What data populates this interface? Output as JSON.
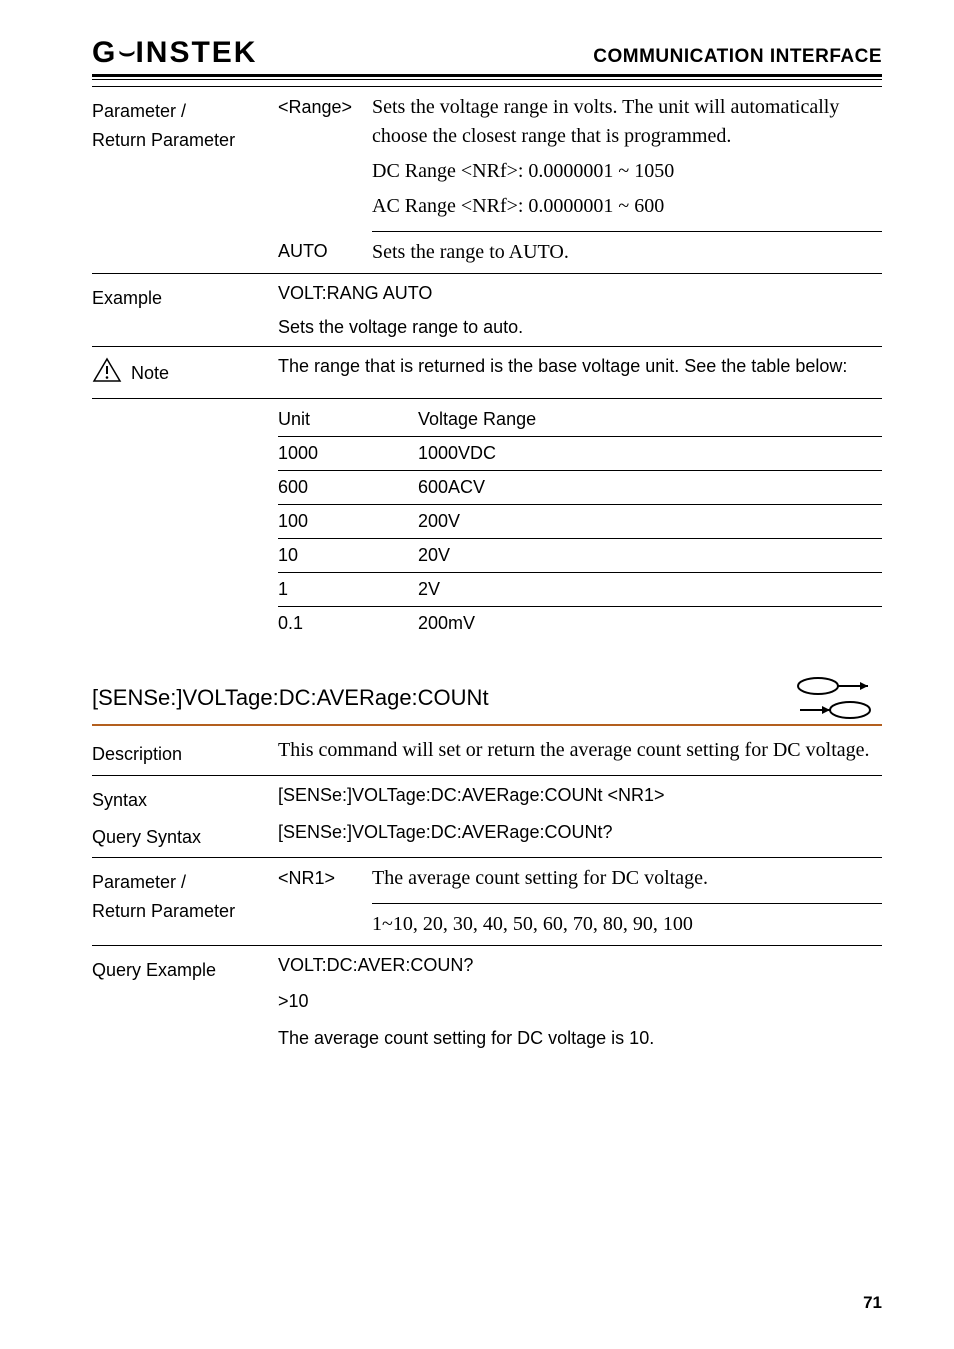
{
  "header": {
    "logo": "GWINSTEK",
    "section": "COMMUNICATION INTERFACE"
  },
  "block1": {
    "param_label_l1": "Parameter /",
    "param_label_l2": "Return Parameter",
    "range_token": "<Range>",
    "range_desc": "Sets the voltage range in volts. The unit will automatically choose the closest range that is programmed.",
    "dc_range": "DC Range <NRf>: 0.0000001 ~ 1050",
    "ac_range": "AC Range <NRf>: 0.0000001 ~ 600",
    "auto_token": "AUTO",
    "auto_desc": "Sets the range to AUTO.",
    "example_label": "Example",
    "example_val": "VOLT:RANG AUTO",
    "example_desc": "Sets the voltage range to auto.",
    "note_label": "Note",
    "note_text": "The range that is returned is the base voltage unit. See the table below:",
    "vr_header_unit": "Unit",
    "vr_header_range": "Voltage Range",
    "vr_rows": [
      {
        "unit": "1000",
        "range": "1000VDC"
      },
      {
        "unit": "600",
        "range": "600ACV"
      },
      {
        "unit": "100",
        "range": "200V"
      },
      {
        "unit": "10",
        "range": "20V"
      },
      {
        "unit": "1",
        "range": "2V"
      },
      {
        "unit": "0.1",
        "range": "200mV"
      }
    ]
  },
  "cmd_heading": "[SENSe:]VOLTage:DC:AVERage:COUNt",
  "block2": {
    "desc_label": "Description",
    "desc_text": "This command will set or return the average count setting for DC voltage.",
    "syntax_label": "Syntax",
    "syntax_val": "[SENSe:]VOLTage:DC:AVERage:COUNt <NR1>",
    "qsyntax_label": "Query Syntax",
    "qsyntax_val": "[SENSe:]VOLTage:DC:AVERage:COUNt?",
    "param_label_l1": "Parameter /",
    "param_label_l2": "Return Parameter",
    "nr1_token": "<NR1>",
    "nr1_desc": "The average count setting for DC voltage.",
    "nr1_values": "1~10, 20, 30, 40, 50, 60, 70, 80, 90, 100",
    "qex_label": "Query Example",
    "qex_l1": "VOLT:DC:AVER:COUN?",
    "qex_l2": ">10",
    "qex_l3": "The average count setting for DC voltage is 10."
  },
  "page_num": "71"
}
